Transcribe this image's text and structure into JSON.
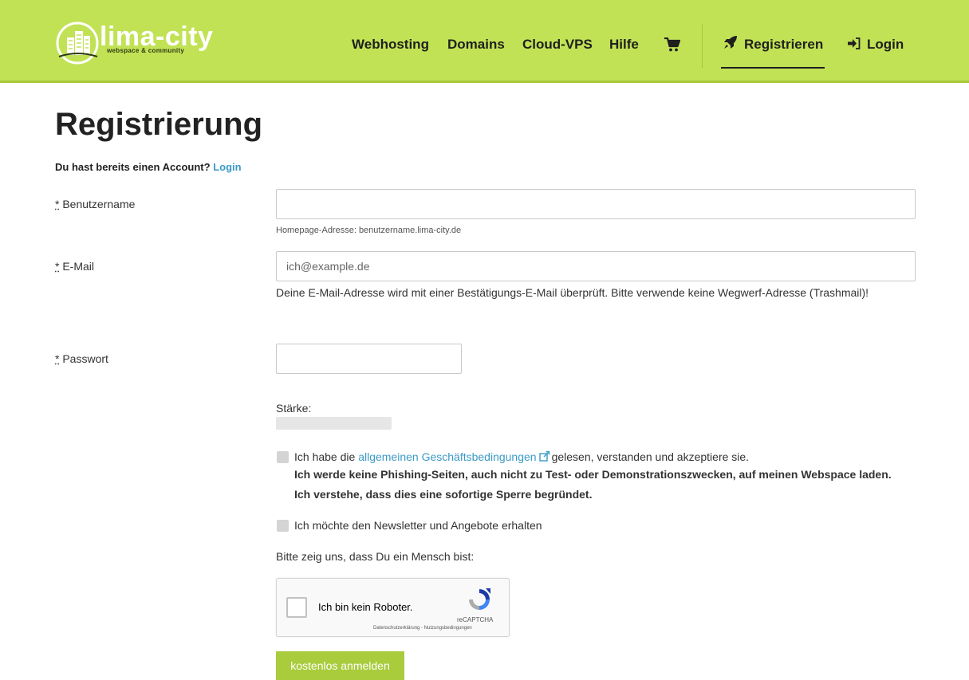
{
  "brand": {
    "name": "lima-city",
    "tagline": "webspace & community",
    "accent_color": "#c2e255",
    "link_color": "#3b9ac5",
    "button_color": "#a8cc3c"
  },
  "nav": {
    "items": [
      {
        "label": "Webhosting"
      },
      {
        "label": "Domains"
      },
      {
        "label": "Cloud-VPS"
      },
      {
        "label": "Hilfe"
      }
    ],
    "cart_icon": "shopping-cart-icon",
    "register": {
      "label": "Registrieren",
      "icon": "rocket-icon",
      "active": true
    },
    "login": {
      "label": "Login",
      "icon": "sign-in-icon"
    }
  },
  "page": {
    "title": "Registrierung",
    "account_question": "Du hast bereits einen Account?",
    "account_link": "Login"
  },
  "form": {
    "required_marker": "*",
    "username": {
      "label": "Benutzername",
      "value": "",
      "placeholder": "",
      "help": "Homepage-Adresse: benutzername.lima-city.de"
    },
    "email": {
      "label": "E-Mail",
      "value": "",
      "placeholder": "ich@example.de",
      "help": "Deine E-Mail-Adresse wird mit einer Bestätigungs-E-Mail überprüft. Bitte verwende keine Wegwerf-Adresse (Trashmail)!"
    },
    "password": {
      "label": "Passwort",
      "value": "",
      "placeholder": "",
      "strength_label": "Stärke:",
      "strength_level": 0
    },
    "terms": {
      "checked": false,
      "text_before": "Ich habe die",
      "link": "allgemeinen Geschäftsbedingungen",
      "text_after": "gelesen, verstanden und akzeptiere sie.",
      "bold_line_1": "Ich werde keine Phishing-Seiten, auch nicht zu Test- oder Demonstrationszwecken, auf meinen Webspace laden.",
      "bold_line_2": "Ich verstehe, dass dies eine sofortige Sperre begründet."
    },
    "newsletter": {
      "checked": false,
      "label": "Ich möchte den Newsletter und Angebote erhalten"
    },
    "captcha": {
      "prompt": "Bitte zeig uns, dass Du ein Mensch bist:",
      "checkbox_label": "Ich bin kein Roboter.",
      "brand": "reCAPTCHA",
      "terms": "Datenschutzerklärung - Nutzungsbedingungen"
    },
    "submit_label": "kostenlos anmelden"
  }
}
